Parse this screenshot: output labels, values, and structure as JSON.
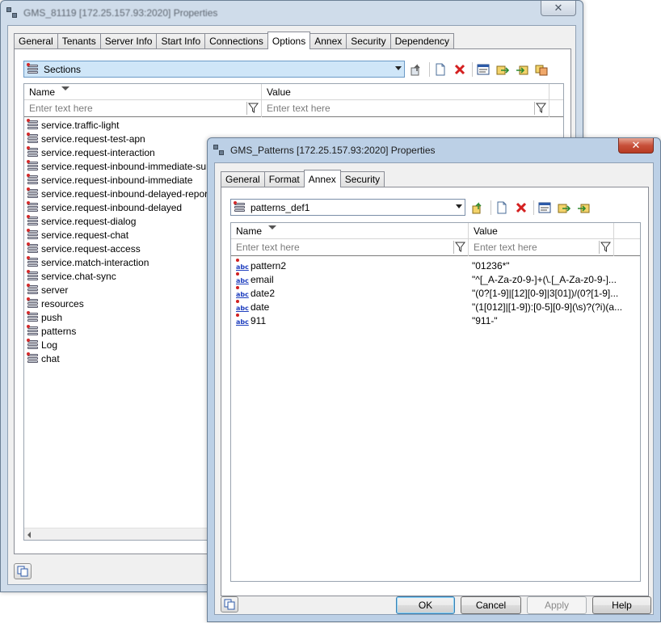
{
  "back_window": {
    "title": "GMS_81119 [172.25.157.93:2020] Properties",
    "close_label": "✕",
    "tabs": [
      {
        "label": "General",
        "active": false
      },
      {
        "label": "Tenants",
        "active": false
      },
      {
        "label": "Server Info",
        "active": false
      },
      {
        "label": "Start Info",
        "active": false
      },
      {
        "label": "Connections",
        "active": false
      },
      {
        "label": "Options",
        "active": true
      },
      {
        "label": "Annex",
        "active": false
      },
      {
        "label": "Security",
        "active": false
      },
      {
        "label": "Dependency",
        "active": false
      }
    ],
    "section_selector": {
      "selected": "Sections"
    },
    "grid": {
      "columns": {
        "name": "Name",
        "value": "Value"
      },
      "filter_placeholder_name": "Enter text here",
      "filter_placeholder_value": "Enter text here",
      "rows": [
        "service.traffic-light",
        "service.request-test-apn",
        "service.request-interaction",
        "service.request-inbound-immediate-survey",
        "service.request-inbound-immediate",
        "service.request-inbound-delayed-reporting",
        "service.request-inbound-delayed",
        "service.request-dialog",
        "service.request-chat",
        "service.request-access",
        "service.match-interaction",
        "service.chat-sync",
        "server",
        "resources",
        "push",
        "patterns",
        "Log",
        "chat"
      ]
    }
  },
  "front_window": {
    "title": "GMS_Patterns [172.25.157.93:2020] Properties",
    "close_label": "✕",
    "tabs": [
      {
        "label": "General",
        "active": false
      },
      {
        "label": "Format",
        "active": false
      },
      {
        "label": "Annex",
        "active": true
      },
      {
        "label": "Security",
        "active": false
      }
    ],
    "section_selector": {
      "selected": "patterns_def1"
    },
    "grid": {
      "columns": {
        "name": "Name",
        "value": "Value"
      },
      "filter_placeholder_name": "Enter text here",
      "filter_placeholder_value": "Enter text here",
      "rows": [
        {
          "name": "pattern2",
          "value": "\"01236*\""
        },
        {
          "name": "email",
          "value": "\"^[_A-Za-z0-9-]+(\\.[_A-Za-z0-9-]..."
        },
        {
          "name": "date2",
          "value": "\"(0?[1-9]|[12][0-9]|3[01])/(0?[1-9]..."
        },
        {
          "name": "date",
          "value": "\"(1[012]|[1-9]):[0-5][0-9](\\s)?(?i)(a..."
        },
        {
          "name": "911",
          "value": "\"911-\""
        }
      ]
    },
    "buttons": {
      "ok": "OK",
      "cancel": "Cancel",
      "apply": "Apply",
      "help": "Help"
    }
  },
  "icons": {
    "window": "properties-window-icon",
    "section": "section-stack-icon",
    "option": "abc-string-option-icon",
    "toolbar": [
      "up-level-icon",
      "new-item-icon",
      "delete-icon",
      "properties-icon",
      "export-icon",
      "import-icon",
      "merge-icon"
    ]
  },
  "colors": {
    "combo_highlight": "#cfe6f8",
    "delete_icon": "#d42020",
    "window_frame": "#bcd0e6"
  }
}
